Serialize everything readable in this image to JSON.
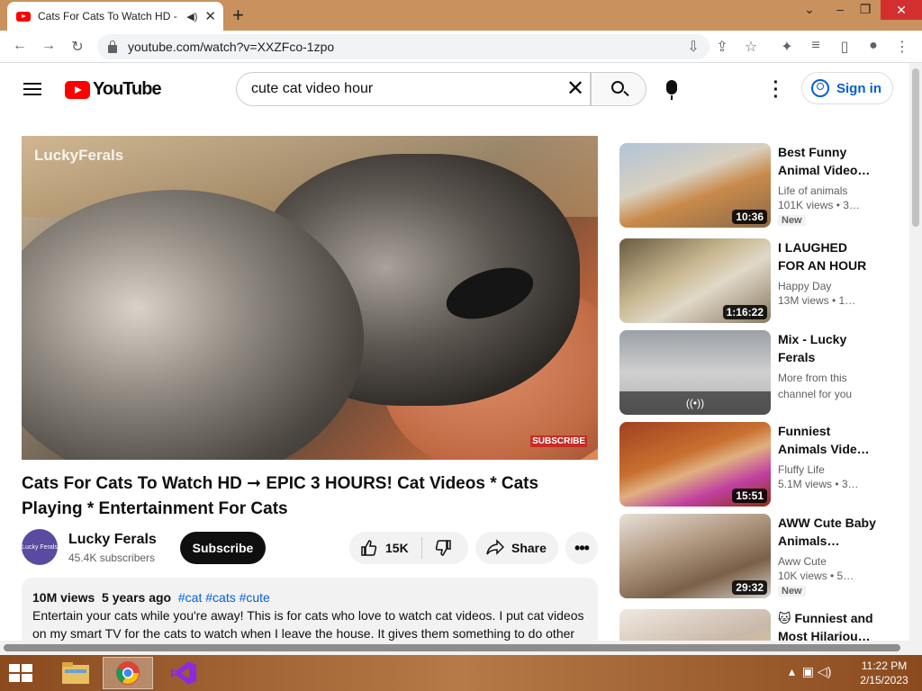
{
  "browser": {
    "tab_title": "Cats For Cats To Watch HD - ",
    "new_tab": "+",
    "url": "youtube.com/watch?v=XXZFco-1zpo",
    "minimize": "⌄",
    "restore": "–",
    "maximize": "❐",
    "close": "✕"
  },
  "youtube": {
    "logo_text": "YouTube",
    "search_query": "cute cat video hour",
    "sign_in": "Sign in"
  },
  "player": {
    "watermark": "LuckyFerals",
    "subscribe_overlay": "SUBSCRIBE"
  },
  "video": {
    "title": "Cats For Cats To Watch HD ➞ EPIC 3 HOURS! Cat Videos * Cats Playing * Entertainment For Cats",
    "channel_name": "Lucky Ferals",
    "channel_avatar_text": "Lucky Ferals",
    "subscribers": "45.4K subscribers",
    "subscribe_label": "Subscribe",
    "likes": "15K",
    "share_label": "Share",
    "views": "10M views",
    "age": "5 years ago",
    "tags": "#cat #cats #cute",
    "description_line1": "Entertain your cats while you're away! This is for cats who love to watch cat videos. I put cat videos",
    "description_line2": "on my smart TV for the cats to watch when I leave the house. It gives them something to do other"
  },
  "recommendations": [
    {
      "title": "Best Funny Animal Video…",
      "channel": "Life of animals",
      "views": "101K views  • 3…",
      "badge": "New",
      "duration": "10:36"
    },
    {
      "title": "I LAUGHED FOR AN HOUR😹…",
      "channel": "Happy Day",
      "views": "13M views  • 1…",
      "badge": "",
      "duration": "1:16:22"
    },
    {
      "title": "Mix - Lucky Ferals",
      "channel": "More from this channel for you",
      "views": "",
      "badge": "",
      "duration": "",
      "mix_icon": "((•))"
    },
    {
      "title": "Funniest Animals Vide…",
      "channel": "Fluffy Life",
      "views": "5.1M views  • 3…",
      "badge": "",
      "duration": "15:51"
    },
    {
      "title": "AWW Cute Baby Animals…",
      "channel": "Aww Cute",
      "views": "10K views  • 5…",
      "badge": "New",
      "duration": "29:32"
    },
    {
      "title": "🐱 Funniest and Most Hilariou…",
      "channel": "",
      "views": "",
      "badge": "",
      "duration": ""
    }
  ],
  "taskbar": {
    "time": "11:22 PM",
    "date": "2/15/2023"
  },
  "colors": {
    "yt_red": "#ff0000",
    "link_blue": "#065fd4",
    "tab_strip": "#c9915e"
  }
}
